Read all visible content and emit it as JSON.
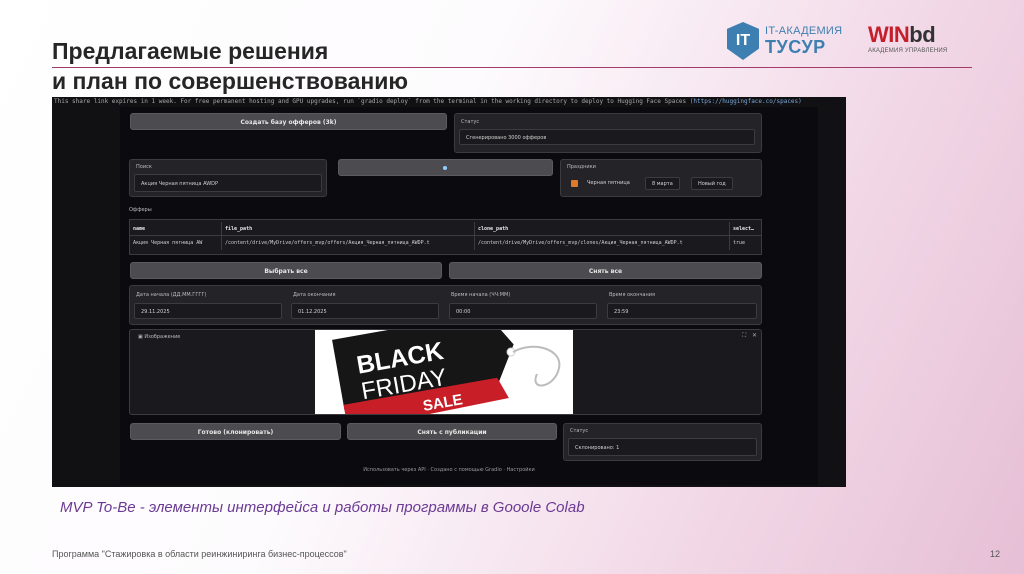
{
  "slide": {
    "title_line1": "Предлагаемые решения",
    "title_line2": "и план по совершенствованию",
    "caption": "MVP To-Be - элементы интерфейса и работы программы в Gooole Colab",
    "footer_program": "Программа \"Стажировка в области реинжиниринга бизнес-процессов\"",
    "page_number": "12"
  },
  "logos": {
    "itacademy_mark": "IT",
    "itacademy_line1": "IT-АКАДЕМИЯ",
    "itacademy_line2": "ТУСУР",
    "winbd_main_a": "WIN",
    "winbd_main_b": "bd",
    "winbd_sub": "АКАДЕМИЯ УПРАВЛЕНИЯ"
  },
  "colab": {
    "share_text": "This share link expires in 1 week. For free permanent hosting and GPU upgrades, run `gradio deploy` from the terminal in the working directory to deploy to Hugging Face Spaces",
    "share_link": "(https://huggingface.co/spaces)",
    "create_button": "Создать базу офферов (3k)",
    "status_label": "Статус",
    "status_value": "Сгенерировано 3000 офферов",
    "search_label": "Поиск",
    "search_value": "Акция Черная пятница AWDP",
    "holidays_label": "Праздники",
    "holidays": [
      "Черная пятница",
      "8 марта",
      "Новый год"
    ],
    "offers_label": "Офферы",
    "table": {
      "headers": [
        "name",
        "file_path",
        "clone_path",
        "select…"
      ],
      "rows": [
        [
          "Акция Черная пятница AW",
          "/content/drive/MyDrive/offers_mvp/offers/Акция_Черная_пятница_AWDP.t",
          "/content/drive/MyDrive/offers_mvp/clones/Акция_Черная_пятница_AWDP.t",
          "true"
        ]
      ]
    },
    "select_all": "Выбрать все",
    "deselect_all": "Снять все",
    "start_date_label": "Дата начала (ДД.ММ.ГГГГ)",
    "start_date": "29.11.2025",
    "end_date_label": "Дата окончания",
    "end_date": "01.12.2025",
    "start_time_label": "Время начала (ЧЧ:ММ)",
    "start_time": "00:00",
    "end_time_label": "Время окончания",
    "end_time": "23:59",
    "image_label": "Изображение",
    "image_text_black": "BLACK",
    "image_text_friday": "FRIDAY",
    "image_text_sale": "SALE",
    "done_button": "Готово (клонировать)",
    "unpublish_button": "Снять с публикации",
    "status2_label": "Статус",
    "status2_value": "Склонировано: 1",
    "footer_text": "Использовать через API  ·  Создано с помощью Gradio  ·  Настройки"
  }
}
